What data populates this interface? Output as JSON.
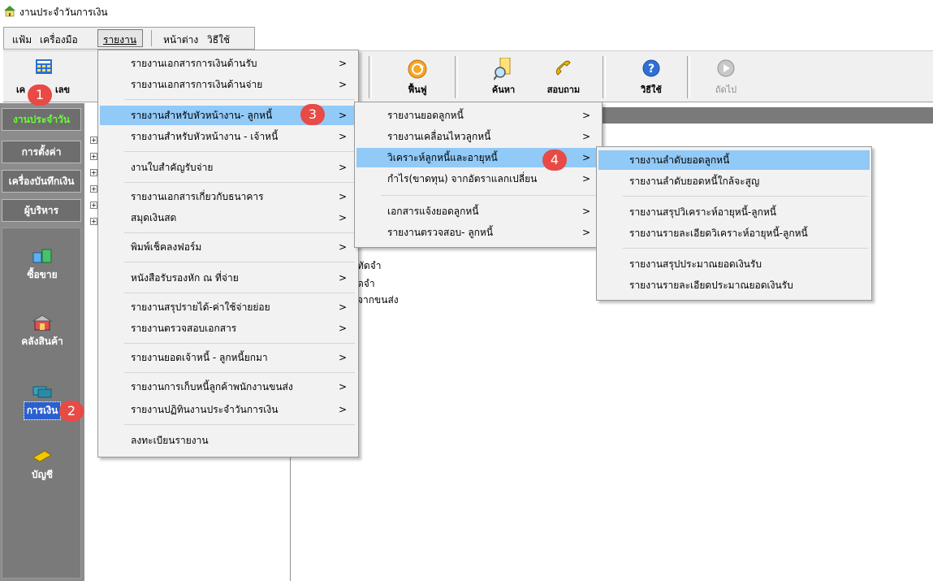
{
  "window": {
    "title": "งานประจำวันการเงิน"
  },
  "menubar": {
    "items": [
      "แฟ้ม",
      "เครื่องมือ",
      "รายงาน",
      "หน้าต่าง",
      "วิธีใช้"
    ]
  },
  "toolbar": {
    "calculator_label": "เครื่องคิดเลข",
    "calculator_visible_label": "เค",
    "calculator_visible_label_end": "เลข",
    "refresh_label": "ฟื้นฟู",
    "search_label": "ค้นหา",
    "inquiry_label": "สอบถาม",
    "help_label": "วิธีใช้",
    "next_label": "ถัดไป"
  },
  "sidebar": {
    "tabs": [
      "งานประจำวัน",
      "การตั้งค่า",
      "เครื่องบันทึกเงิน",
      "ผู้บริหาร"
    ],
    "modules": [
      "ซื้อขาย",
      "คลังสินค้า",
      "การเงิน",
      "บัญชี"
    ]
  },
  "background_text": [
    "ทัดจำ",
    "ดจำ",
    "จากขนส่ง"
  ],
  "report_menu": {
    "items": [
      "รายงานเอกสารการเงินด้านรับ",
      "รายงานเอกสารการเงินด้านจ่าย",
      "รายงานสำหรับหัวหน้างาน- ลูกหนี้",
      "รายงานสำหรับหัวหน้างาน - เจ้าหนี้",
      "งานใบสำคัญรับจ่าย",
      "รายงานเอกสารเกี่ยวกับธนาคาร",
      "สมุดเงินสด",
      "พิมพ์เช็คลงฟอร์ม",
      "หนังสือรับรองหัก ณ ที่จ่าย",
      "รายงานสรุปรายได้-ค่าใช้จ่ายย่อย",
      "รายงานตรวจสอบเอกสาร",
      "รายงานยอดเจ้าหนี้ - ลูกหนี้ยกมา",
      "รายงานการเก็บหนี้ลูกค้าพนักงานขนส่ง",
      "รายงานปฏิทินงานประจำวันการเงิน",
      "ลงทะเบียนรายงาน"
    ]
  },
  "debtor_menu": {
    "items": [
      "รายงานยอดลูกหนี้",
      "รายงานเคลื่อนไหวลูกหนี้",
      "วิเคราะห์ลูกหนี้และอายุหนี้",
      "กำไร(ขาดทุน) จากอัตราแลกเปลี่ยน",
      "เอกสารแจ้งยอดลูกหนี้",
      "รายงานตรวจสอบ- ลูกหนี้"
    ]
  },
  "analysis_menu": {
    "items": [
      "รายงานลำดับยอดลูกหนี้",
      "รายงานลำดับยอดหนี้ใกล้จะสูญ",
      "รายงานสรุปวิเคราะห์อายุหนี้-ลูกหนี้",
      "รายงานรายละเอียดวิเคราะห์อายุหนี้-ลูกหนี้",
      "รายงานสรุปประมาณยอดเงินรับ",
      "รายงานรายละเอียดประมาณยอดเงินรับ"
    ]
  },
  "badges": [
    "1",
    "2",
    "3",
    "4"
  ],
  "submenu_arrow": ">",
  "colors": {
    "highlight": "#91c9f7",
    "badge": "#e84a45",
    "sidebar_active_text": "#66ff33"
  }
}
